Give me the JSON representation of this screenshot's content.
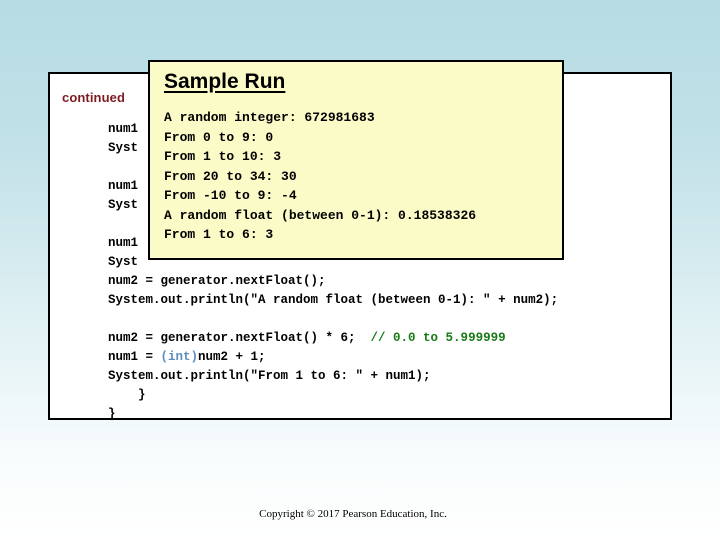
{
  "slide": {
    "background_top_color": "#b7dce4",
    "background_bottom_color": "#ffffff"
  },
  "code_panel": {
    "continued_label": "continued",
    "continued_color": "#7d1c22",
    "hidden_code_lines": "num1\nSyst\n\nnum1\nSyst\n\nnum1\nSyst",
    "visible_code": {
      "line1": "num2 = generator.nextFloat();",
      "line2": "System.out.println(\"A random float (between 0-1): \" + num2);",
      "line3": "",
      "line4_code": "num2 = generator.nextFloat() * 6;  ",
      "line4_comment": "// 0.0 to 5.999999",
      "line5_a": "num1 = ",
      "line5_keyword": "(int)",
      "line5_b": "num2 + 1;",
      "line6": "System.out.println(\"From 1 to 6: \" + num1);",
      "line7": "    }",
      "line8": "}"
    },
    "comment_color": "#177a17",
    "keyword_color": "#5e8fbf"
  },
  "sample_run": {
    "title": "Sample Run",
    "background_color": "#fbfbc8",
    "output_lines": [
      "A random integer: 672981683",
      "From 0 to 9: 0",
      "From 1 to 10: 3",
      "From 20 to 34: 30",
      "From -10 to 9: -4",
      "A random float (between 0-1): 0.18538326",
      "From 1 to 6: 3"
    ],
    "output_text": "A random integer: 672981683\nFrom 0 to 9: 0\nFrom 1 to 10: 3\nFrom 20 to 34: 30\nFrom -10 to 9: -4\nA random float (between 0-1): 0.18538326\nFrom 1 to 6: 3"
  },
  "footer": {
    "copyright": "Copyright © 2017 Pearson Education, Inc."
  }
}
